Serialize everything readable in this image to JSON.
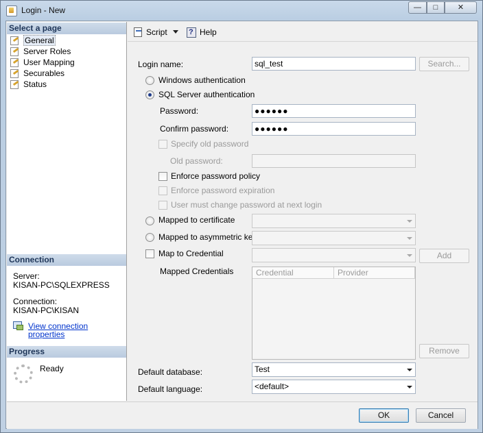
{
  "window": {
    "title": "Login - New",
    "minimize_glyph": "—",
    "maximize_glyph": "□",
    "close_glyph": "✕"
  },
  "left": {
    "select_page_header": "Select a page",
    "pages": [
      {
        "label": "General",
        "icon": "page-icon"
      },
      {
        "label": "Server Roles",
        "icon": "page-icon"
      },
      {
        "label": "User Mapping",
        "icon": "page-icon"
      },
      {
        "label": "Securables",
        "icon": "page-icon"
      },
      {
        "label": "Status",
        "icon": "page-icon"
      }
    ],
    "connection_header": "Connection",
    "server_label": "Server:",
    "server_value": "KISAN-PC\\SQLEXPRESS",
    "connection_label": "Connection:",
    "connection_value": "KISAN-PC\\KISAN",
    "view_connection_link": "View connection properties",
    "progress_header": "Progress",
    "progress_status": "Ready"
  },
  "toolbar": {
    "script_label": "Script",
    "help_label": "Help"
  },
  "form": {
    "login_name_label": "Login name:",
    "login_name_value": "sql_test",
    "search_button": "Search...",
    "windows_auth_label": "Windows authentication",
    "sql_auth_label": "SQL Server authentication",
    "password_label": "Password:",
    "password_value": "●●●●●●",
    "confirm_password_label": "Confirm password:",
    "confirm_password_value": "●●●●●●",
    "specify_old_password_label": "Specify old password",
    "old_password_label": "Old password:",
    "enforce_policy_label": "Enforce password policy",
    "enforce_expiration_label": "Enforce password expiration",
    "must_change_label": "User must change password at next login",
    "mapped_certificate_label": "Mapped to certificate",
    "mapped_asymmetric_label": "Mapped to asymmetric key",
    "map_credential_label": "Map to Credential",
    "add_button": "Add",
    "mapped_credentials_label": "Mapped Credentials",
    "credentials_columns": [
      "Credential",
      "Provider"
    ],
    "remove_button": "Remove",
    "default_database_label": "Default database:",
    "default_database_value": "Test",
    "default_language_label": "Default language:",
    "default_language_value": "<default>"
  },
  "footer": {
    "ok_button": "OK",
    "cancel_button": "Cancel"
  },
  "colors": {
    "link": "#0033cc",
    "section_header_text": "#1e3558",
    "radio_dot": "#1e3b8a"
  }
}
